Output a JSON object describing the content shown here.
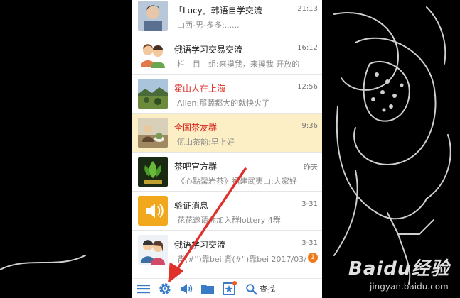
{
  "conversations": [
    {
      "name": "「Lucy」韩语自学交流",
      "time": "21:13",
      "preview": "山西-男-多多:......",
      "name_color": "normal",
      "avatar": "photo-person-icon"
    },
    {
      "name": "俄语学习交易交流",
      "time": "16:12",
      "preview": "栏　目　组:来摸我，来摸我 开放的",
      "name_color": "normal",
      "avatar": "group-people-icon"
    },
    {
      "name": "霍山人在上海",
      "time": "12:56",
      "preview": "Allen:那蔬都大的就快火了",
      "name_color": "red",
      "avatar": "landscape-photo-icon"
    },
    {
      "name": "全国茶友群",
      "time": "9:36",
      "preview": "佤山茶韵:早上好",
      "name_color": "red",
      "avatar": "tea-photo-icon",
      "selected": true
    },
    {
      "name": "茶吧官方群",
      "time": "昨天",
      "preview": "《心點馨岩茶》福建武夷山:大家好",
      "name_color": "normal",
      "avatar": "tea-logo-icon"
    },
    {
      "name": "验证消息",
      "time": "3-31",
      "preview": "花花邀请你加入群lottery 4群",
      "name_color": "normal",
      "avatar": "speaker-icon"
    },
    {
      "name": "俄语学习交流",
      "time": "3-31",
      "preview": "背(#'')靠bei:背(#'')靠bei 2017/03/",
      "name_color": "normal",
      "avatar": "group-people-icon",
      "unread": "1"
    }
  ],
  "toolbar": {
    "find_label": "查找",
    "icons": [
      "menu-icon",
      "settings-icon",
      "speaker-icon",
      "folder-icon",
      "favorite-icon",
      "search-icon"
    ]
  },
  "watermark": {
    "text": "Baidu经验",
    "url": "jingyan.baidu.com"
  },
  "colors": {
    "selected_bg": "#fcefc6",
    "alert_name": "#d9241c",
    "toolbar_icon": "#3a7bc8",
    "arrow": "#e0302a"
  }
}
